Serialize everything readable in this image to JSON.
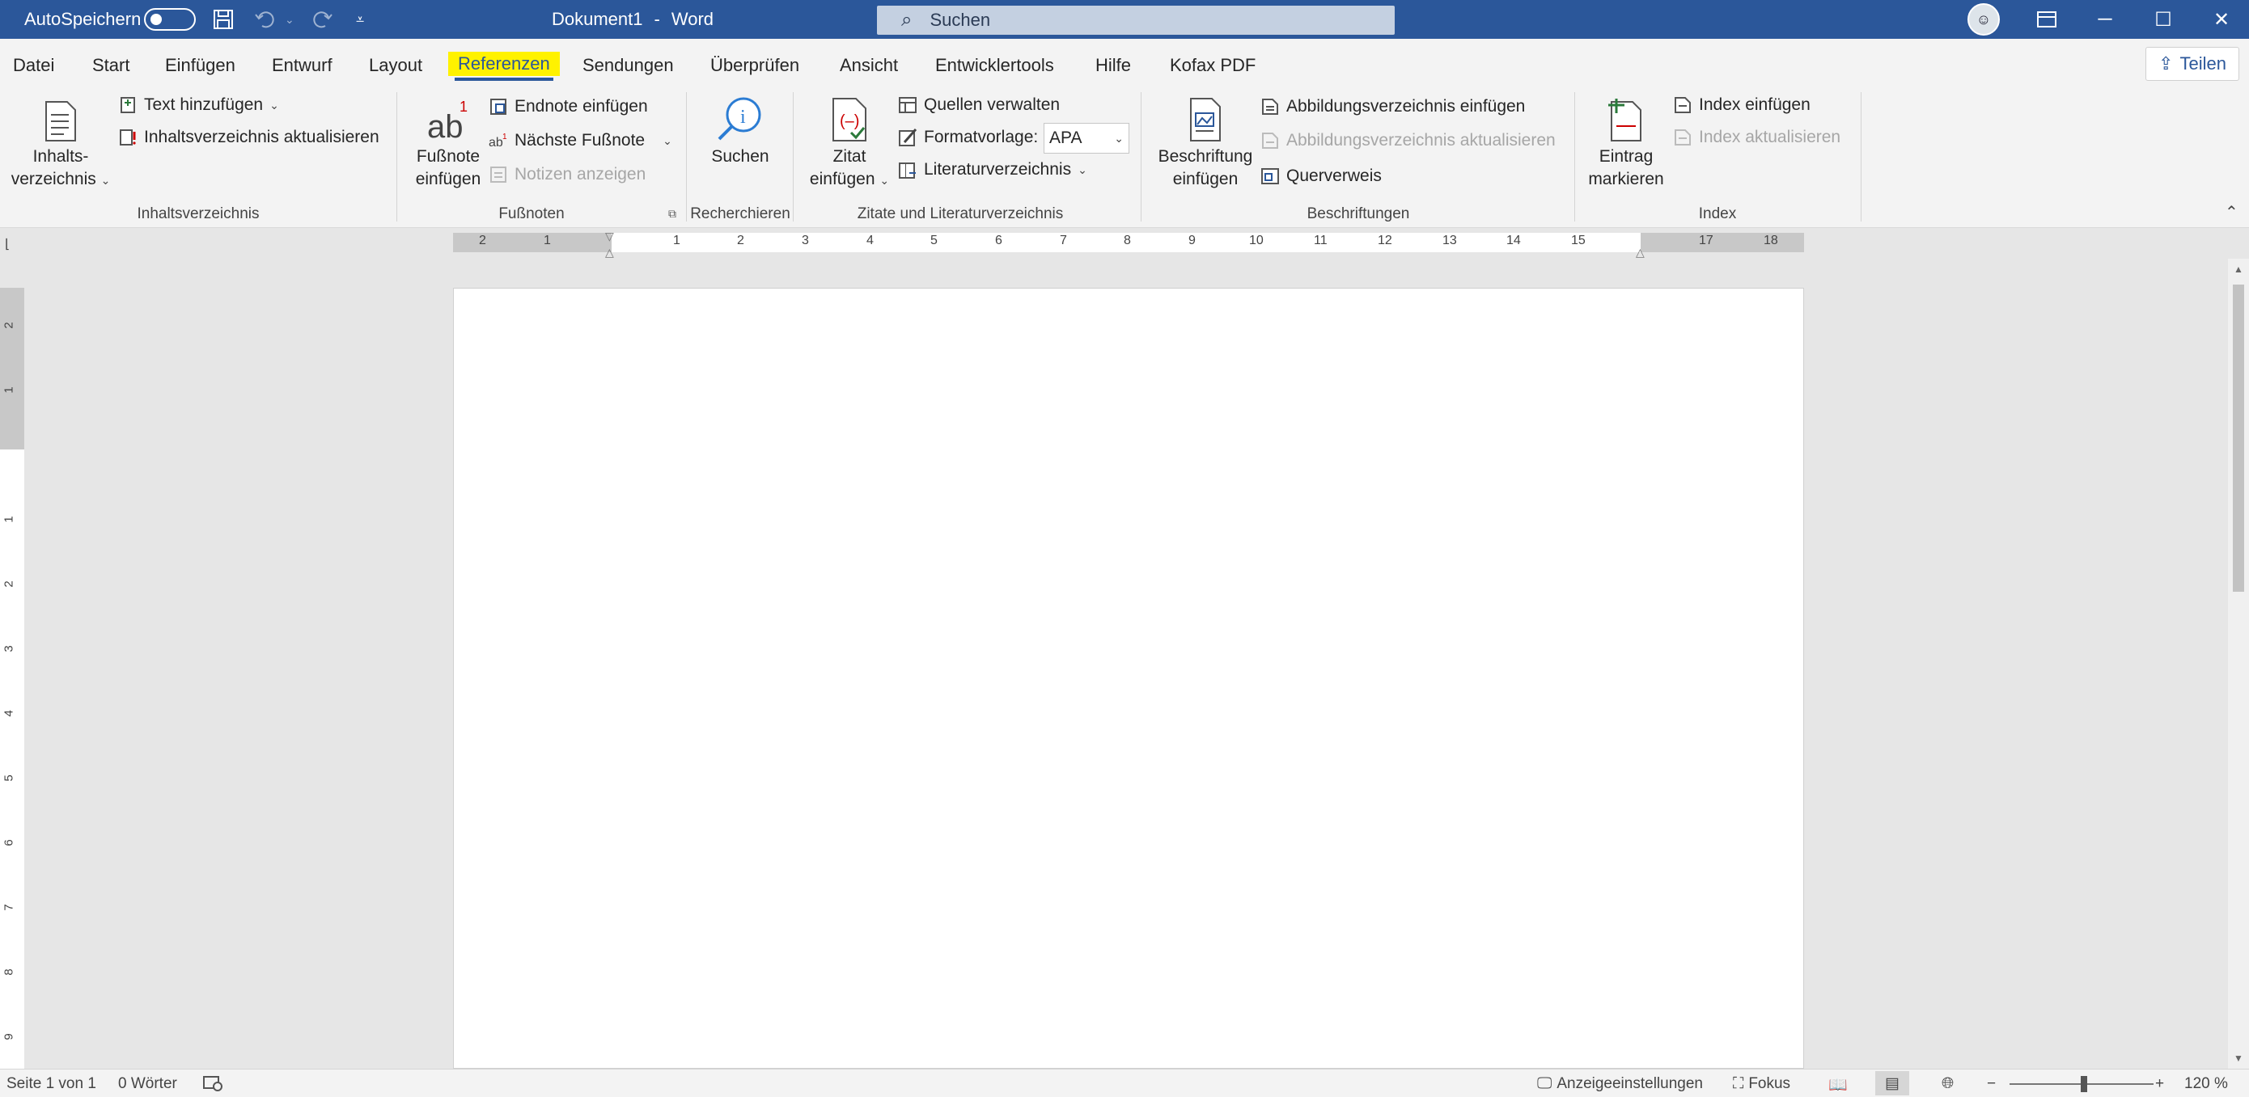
{
  "titlebar": {
    "autosave_label": "AutoSpeichern",
    "doc_title": "Dokument1",
    "separator": "-",
    "app_name": "Word",
    "search_placeholder": "Suchen",
    "bg_color": "#2b579a"
  },
  "menu": {
    "items": [
      "Datei",
      "Start",
      "Einfügen",
      "Entwurf",
      "Layout",
      "Referenzen",
      "Sendungen",
      "Überprüfen",
      "Ansicht",
      "Entwicklertools",
      "Hilfe",
      "Kofax PDF"
    ],
    "active": "Referenzen",
    "share_label": "Teilen",
    "highlight_color": "#fff200"
  },
  "ribbon": {
    "toc": {
      "big_line1": "Inhalts-",
      "big_line2": "verzeichnis",
      "add_text": "Text hinzufügen",
      "update": "Inhaltsverzeichnis aktualisieren",
      "label": "Inhaltsverzeichnis"
    },
    "footnotes": {
      "big_line1": "Fußnote",
      "big_line2": "einfügen",
      "endnote": "Endnote einfügen",
      "next": "Nächste Fußnote",
      "show_notes": "Notizen anzeigen",
      "label": "Fußnoten"
    },
    "research": {
      "big": "Suchen",
      "label": "Recherchieren"
    },
    "citations": {
      "big_line1": "Zitat",
      "big_line2": "einfügen",
      "manage": "Quellen verwalten",
      "style_label": "Formatvorlage:",
      "style_value": "APA",
      "bibliography": "Literaturverzeichnis",
      "label": "Zitate und Literaturverzeichnis"
    },
    "captions": {
      "big_line1": "Beschriftung",
      "big_line2": "einfügen",
      "insert_tof": "Abbildungsverzeichnis einfügen",
      "update_tof": "Abbildungsverzeichnis aktualisieren",
      "cross_ref": "Querverweis",
      "label": "Beschriftungen"
    },
    "index": {
      "big_line1": "Eintrag",
      "big_line2": "markieren",
      "insert": "Index einfügen",
      "update": "Index aktualisieren",
      "label": "Index"
    }
  },
  "ruler": {
    "left_ticks": [
      "2",
      "1"
    ],
    "right_ticks": [
      "1",
      "2",
      "3",
      "4",
      "5",
      "6",
      "7",
      "8",
      "9",
      "10",
      "11",
      "12",
      "13",
      "14",
      "15",
      "17",
      "18"
    ],
    "vertical_ticks_top": [
      "2",
      "1"
    ],
    "vertical_ticks": [
      "1",
      "2",
      "3",
      "4",
      "5",
      "6",
      "7",
      "8",
      "9"
    ]
  },
  "status": {
    "page": "Seite 1 von 1",
    "words": "0 Wörter",
    "display_settings": "Anzeigeeinstellungen",
    "focus": "Fokus",
    "zoom": "120 %",
    "zoom_minus": "−",
    "zoom_plus": "+"
  }
}
